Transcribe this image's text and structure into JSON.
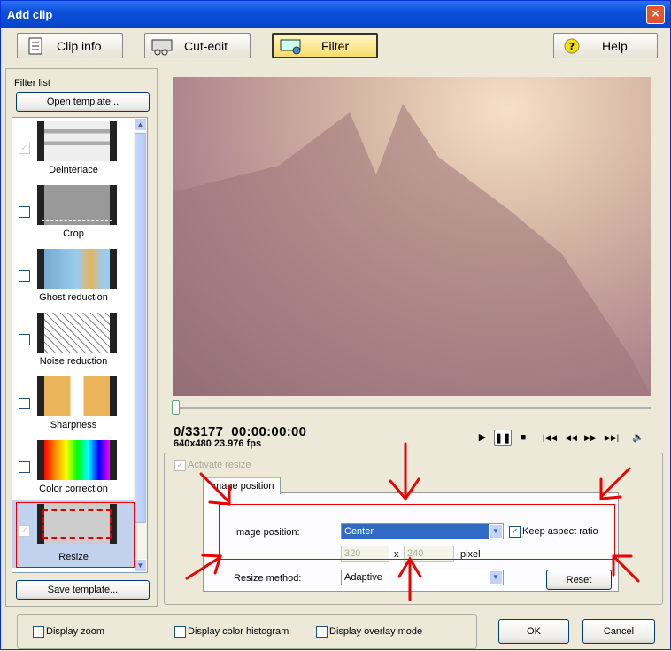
{
  "window": {
    "title": "Add clip",
    "close": "×"
  },
  "toolbar": {
    "clip_info": "Clip info",
    "cut_edit": "Cut-edit",
    "filter": "Filter",
    "help": "Help"
  },
  "left": {
    "filter_list_label": "Filter list",
    "open_template": "Open template...",
    "save_template": "Save template...",
    "items": [
      {
        "label": "Deinterlace",
        "checked": true,
        "disabled": true
      },
      {
        "label": "Crop",
        "checked": false
      },
      {
        "label": "Ghost reduction",
        "checked": false
      },
      {
        "label": "Noise reduction",
        "checked": false
      },
      {
        "label": "Sharpness",
        "checked": false
      },
      {
        "label": "Color correction",
        "checked": false
      },
      {
        "label": "Resize",
        "checked": true,
        "selected": true
      }
    ]
  },
  "player": {
    "position": "0/33177",
    "timecode": "00:00:00:00",
    "info": "640x480 23.976 fps"
  },
  "resize": {
    "activate_label": "Activate resize",
    "tab_label": "Image position",
    "image_position_label": "Image position:",
    "image_position_value": "Center",
    "keep_aspect_label": "Keep aspect ratio",
    "width": "320",
    "x_sep": "x",
    "height": "240",
    "unit": "pixel",
    "resize_method_label": "Resize method:",
    "resize_method_value": "Adaptive",
    "reset": "Reset"
  },
  "footer": {
    "display_zoom": "Display zoom",
    "display_histogram": "Display color histogram",
    "display_overlay": "Display overlay mode",
    "ok": "OK",
    "cancel": "Cancel"
  },
  "colors": {
    "accent": "#0a4fd9",
    "annotation": "#e00000",
    "selection": "#c1d2ee"
  }
}
